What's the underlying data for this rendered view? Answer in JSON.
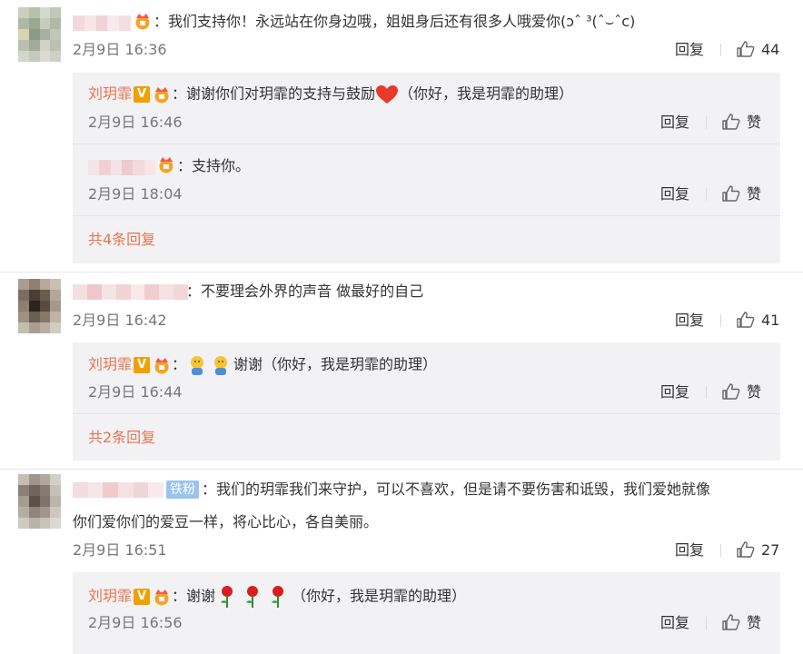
{
  "reply_label": "回复",
  "like_label": "赞",
  "assistant": {
    "name": "刘玥霏",
    "vip": "V"
  },
  "fan_badge": "铁粉",
  "comments": [
    {
      "text": "：我们支持你！永远站在你身边哦，姐姐身后还有很多人哦爱你(ɔˆ ³(ˆ⌣ˆc)",
      "time": "2月9日 16:36",
      "likes": "44",
      "replies": [
        {
          "text": "：谢谢你们对玥霏的支持与鼓励",
          "suffix": "（你好，我是玥霏的助理）",
          "time": "2月9日 16:46"
        },
        {
          "text": "：支持你。",
          "time": "2月9日 18:04"
        }
      ],
      "more": "共4条回复"
    },
    {
      "text": "：不要理会外界的声音 做最好的自己",
      "time": "2月9日 16:42",
      "likes": "41",
      "replies": [
        {
          "text": "：",
          "suffix": "谢谢（你好，我是玥霏的助理）",
          "time": "2月9日 16:44"
        }
      ],
      "more": "共2条回复"
    },
    {
      "text_line1": "：我们的玥霏我们来守护，可以不喜欢，但是请不要伤害和诋毁，我们爱她就像",
      "text_line2": "你们爱你们的爱豆一样，将心比心，各自美丽。",
      "time": "2月9日 16:51",
      "likes": "27",
      "replies": [
        {
          "text": "：谢谢",
          "suffix": "（你好，我是玥霏的助理）",
          "time": "2月9日 16:56"
        }
      ]
    }
  ]
}
